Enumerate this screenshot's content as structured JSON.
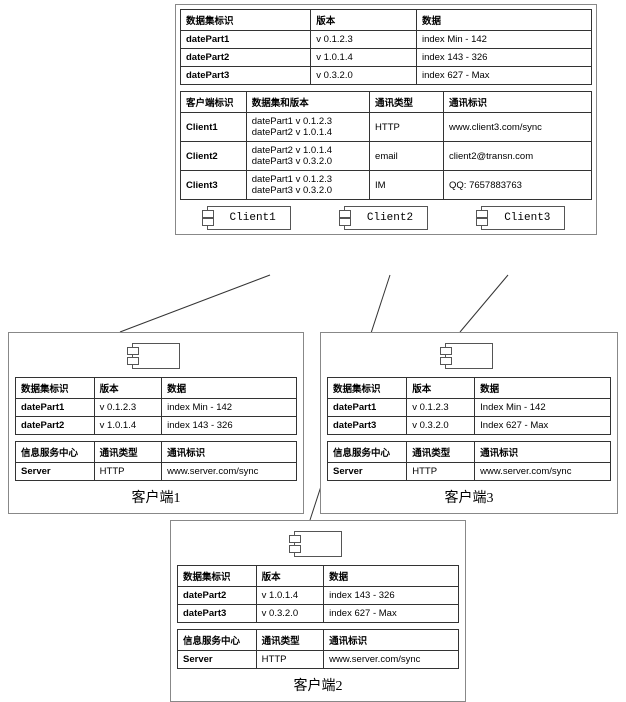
{
  "server": {
    "t1": {
      "h": [
        "数据集标识",
        "版本",
        "数据"
      ],
      "rows": [
        [
          "datePart1",
          "v 0.1.2.3",
          "index Min - 142"
        ],
        [
          "datePart2",
          "v 1.0.1.4",
          "index 143 - 326"
        ],
        [
          "datePart3",
          "v 0.3.2.0",
          "index 627 - Max"
        ]
      ]
    },
    "t2": {
      "h": [
        "客户端标识",
        "数据集和版本",
        "通讯类型",
        "通讯标识"
      ],
      "rows": [
        [
          "Client1",
          "datePart1 v 0.1.2.3\ndatePart2 v 1.0.1.4",
          "HTTP",
          "www.client3.com/sync"
        ],
        [
          "Client2",
          "datePart2 v 1.0.1.4\ndatePart3 v 0.3.2.0",
          "email",
          "client2@transn.com"
        ],
        [
          "Client3",
          "datePart1 v 0.1.2.3\ndatePart3 v 0.3.2.0",
          "IM",
          "QQ: 7657883763"
        ]
      ]
    },
    "comps": [
      "Client1",
      "Client2",
      "Client3"
    ]
  },
  "clients": {
    "c1": {
      "label": "客户端1",
      "t1": {
        "h": [
          "数据集标识",
          "版本",
          "数据"
        ],
        "rows": [
          [
            "datePart1",
            "v 0.1.2.3",
            "index Min - 142"
          ],
          [
            "datePart2",
            "v 1.0.1.4",
            "index 143 - 326"
          ]
        ]
      },
      "t2": {
        "h": [
          "信息服务中心",
          "通讯类型",
          "通讯标识"
        ],
        "rows": [
          [
            "Server",
            "HTTP",
            "www.server.com/sync"
          ]
        ]
      }
    },
    "c2": {
      "label": "客户端2",
      "t1": {
        "h": [
          "数据集标识",
          "版本",
          "数据"
        ],
        "rows": [
          [
            "datePart2",
            "v 1.0.1.4",
            "index 143 - 326"
          ],
          [
            "datePart3",
            "v 0.3.2.0",
            "index 627 - Max"
          ]
        ]
      },
      "t2": {
        "h": [
          "信息服务中心",
          "通讯类型",
          "通讯标识"
        ],
        "rows": [
          [
            "Server",
            "HTTP",
            "www.server.com/sync"
          ]
        ]
      }
    },
    "c3": {
      "label": "客户端3",
      "t1": {
        "h": [
          "数据集标识",
          "版本",
          "数据"
        ],
        "rows": [
          [
            "datePart1",
            "v 0.1.2.3",
            "Index Min - 142"
          ],
          [
            "datePart3",
            "v 0.3.2.0",
            "Index 627 - Max"
          ]
        ]
      },
      "t2": {
        "h": [
          "信息服务中心",
          "通讯类型",
          "通讯标识"
        ],
        "rows": [
          [
            "Server",
            "HTTP",
            "www.server.com/sync"
          ]
        ]
      }
    }
  }
}
